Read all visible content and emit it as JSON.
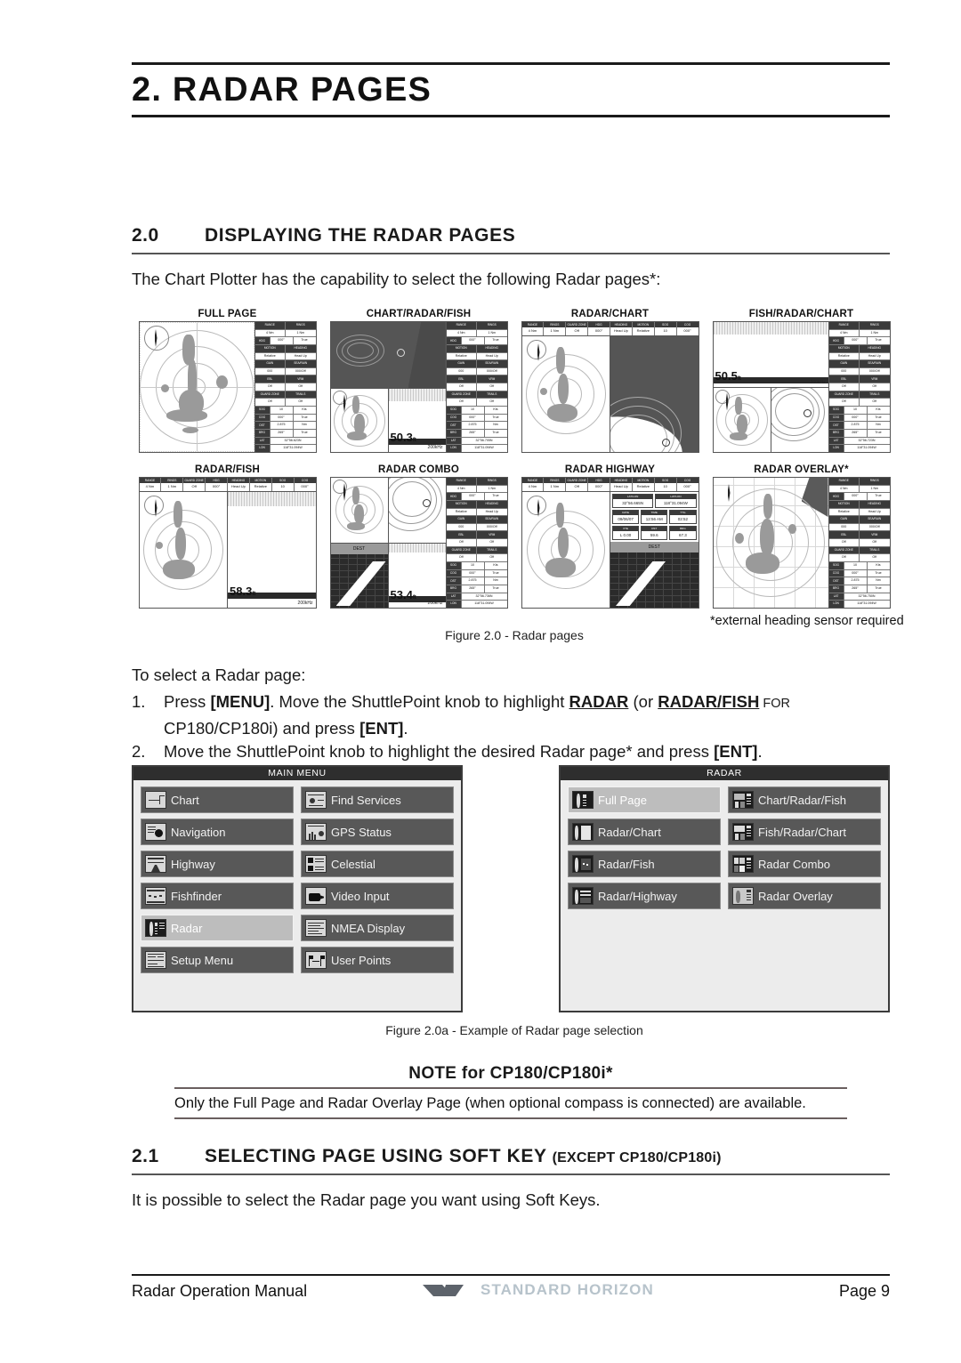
{
  "chapter": {
    "title": "2. RADAR PAGES"
  },
  "sections": {
    "s20": {
      "number": "2.0",
      "title": "DISPLAYING THE RADAR PAGES",
      "intro": "The Chart Plotter has the capability to select the following Radar pages*:"
    },
    "s21": {
      "number": "2.1",
      "title": "SELECTING PAGE USING SOFT KEY ",
      "title_small": "(EXCEPT CP180/CP180i)",
      "body": "It is possible to select the Radar page you want using Soft Keys."
    }
  },
  "figure_20": {
    "caption": "Figure 2.0 - Radar pages",
    "footnote": "*external heading sensor required",
    "thumbs": [
      {
        "label": "FULL PAGE",
        "kind": "full"
      },
      {
        "label": "CHART/RADAR/FISH",
        "kind": "chart_radar_fish"
      },
      {
        "label": "RADAR/CHART",
        "kind": "radar_chart"
      },
      {
        "label": "FISH/RADAR/CHART",
        "kind": "fish_radar_chart"
      },
      {
        "label": "RADAR/FISH",
        "kind": "radar_fish"
      },
      {
        "label": "RADAR COMBO",
        "kind": "radar_combo"
      },
      {
        "label": "RADAR HIGHWAY",
        "kind": "radar_highway"
      },
      {
        "label": "RADAR OVERLAY*",
        "kind": "radar_overlay"
      }
    ],
    "data_panel": {
      "rows": [
        {
          "headers": [
            "RANGE",
            "RINGS"
          ],
          "values": [
            "4 Nm",
            "1 Nm"
          ]
        },
        {
          "headers": [
            "HDG",
            ""
          ],
          "values": [
            "000°",
            "True"
          ]
        },
        {
          "headers": [
            "MOTION",
            "HEADING"
          ],
          "values": [
            "Relative",
            "Head Up"
          ]
        },
        {
          "headers": [
            "GAIN",
            "SEA/RAIN"
          ],
          "values": [
            "000",
            "000/Off"
          ]
        },
        {
          "headers": [
            "EBL",
            "VRM"
          ],
          "values": [
            "Off",
            "Off"
          ]
        },
        {
          "headers": [
            "GUARD ZONE",
            "TRAILS"
          ],
          "values": [
            "Off",
            "Off"
          ]
        },
        {
          "headers": [
            "SOG",
            ""
          ],
          "values": [
            "10",
            "Kts"
          ]
        },
        {
          "headers": [
            "COG",
            ""
          ],
          "values": [
            "000°",
            "True"
          ]
        },
        {
          "headers": [
            "DST",
            ""
          ],
          "values": [
            "2.875",
            "Nm"
          ]
        },
        {
          "headers": [
            "BRG",
            ""
          ],
          "values": [
            "265°",
            "True"
          ]
        },
        {
          "headers": [
            "LAT",
            ""
          ],
          "values": [
            "32°56.623N",
            ""
          ]
        },
        {
          "headers": [
            "LON",
            ""
          ],
          "values": [
            "118°31.094W",
            ""
          ]
        }
      ]
    },
    "depths": {
      "chart_radar_fish": "50.3",
      "fish_radar_chart": "50.5",
      "radar_fish": "58.3",
      "radar_combo": "53.4",
      "unit": "ft",
      "frequency": "200kHz"
    },
    "highway_fields": {
      "lat_label": "LAT/LON",
      "lon_label": "LAT/LON",
      "lat": "32°56.665N",
      "lon": "118°31.094W",
      "date_label": "DATE",
      "time_label": "TIME",
      "ttg_label": "TTG",
      "date": "09/06/07",
      "time": "12:56 AM",
      "ttg": "02:52",
      "xte_label": "XTE",
      "dst_label": "DST",
      "brg_label": "BRG",
      "xte": "L 0.00",
      "dst": "59.6",
      "brg": "67.3",
      "dest": "DEST"
    }
  },
  "instructions": {
    "lead": "To select a Radar page:",
    "step1": {
      "number": "1.",
      "part_a": "Press ",
      "key_menu": "[MENU]",
      "part_b": ". Move the ShuttlePoint knob to highlight ",
      "hl_radar": "RADAR",
      "part_c": " (or ",
      "hl_radar_fish": "RADAR/FISH",
      "part_d": " FOR",
      "line2_a": "CP180/CP180i) and press ",
      "key_ent": "[ENT]",
      "line2_b": "."
    },
    "step2": {
      "number": "2.",
      "part_a": "Move the ShuttlePoint knob to highlight the desired Radar page* and press ",
      "key_ent": "[ENT]",
      "part_b": "."
    }
  },
  "main_menu": {
    "title": "MAIN MENU",
    "items": [
      {
        "label": "Chart",
        "icon": "chart-icon",
        "selected": false
      },
      {
        "label": "Find Services",
        "icon": "find-services-icon",
        "selected": false
      },
      {
        "label": "Navigation",
        "icon": "navigation-icon",
        "selected": false
      },
      {
        "label": "GPS Status",
        "icon": "gps-status-icon",
        "selected": false
      },
      {
        "label": "Highway",
        "icon": "highway-icon",
        "selected": false
      },
      {
        "label": "Celestial",
        "icon": "celestial-icon",
        "selected": false
      },
      {
        "label": "Fishfinder",
        "icon": "fishfinder-icon",
        "selected": false
      },
      {
        "label": "Video Input",
        "icon": "video-input-icon",
        "selected": false
      },
      {
        "label": "Radar",
        "icon": "radar-icon",
        "selected": true
      },
      {
        "label": "NMEA Display",
        "icon": "nmea-display-icon",
        "selected": false
      },
      {
        "label": "Setup Menu",
        "icon": "setup-menu-icon",
        "selected": false
      },
      {
        "label": "User Points",
        "icon": "user-points-icon",
        "selected": false
      }
    ]
  },
  "radar_menu": {
    "title": "RADAR",
    "items": [
      {
        "label": "Full Page",
        "icon": "full-page-icon",
        "selected": true
      },
      {
        "label": "Chart/Radar/Fish",
        "icon": "chart-radar-fish-icon",
        "selected": false
      },
      {
        "label": "Radar/Chart",
        "icon": "radar-chart-icon",
        "selected": false
      },
      {
        "label": "Fish/Radar/Chart",
        "icon": "fish-radar-chart-icon",
        "selected": false
      },
      {
        "label": "Radar/Fish",
        "icon": "radar-fish-icon",
        "selected": false
      },
      {
        "label": "Radar Combo",
        "icon": "radar-combo-icon",
        "selected": false
      },
      {
        "label": "Radar/Highway",
        "icon": "radar-highway-icon",
        "selected": false
      },
      {
        "label": "Radar Overlay",
        "icon": "radar-overlay-icon",
        "selected": false
      }
    ]
  },
  "figure_20a": {
    "caption": "Figure 2.0a - Example of Radar page selection"
  },
  "note": {
    "title": "NOTE for CP180/CP180i*",
    "body": "Only the Full Page and Radar Overlay Page (when optional compass is connected) are available."
  },
  "footer": {
    "left": "Radar Operation Manual",
    "brand": "STANDARD HORIZON",
    "right": "Page 9"
  },
  "colors": {
    "ink": "#1a1a1a",
    "menu_bg": "#ececec",
    "menu_item": "#585858",
    "menu_item_selected": "#bdbdbd",
    "menu_title_bar": "#2e2e2e",
    "brand_text": "#b7c3cb",
    "brand_mark": "#5d636b"
  }
}
